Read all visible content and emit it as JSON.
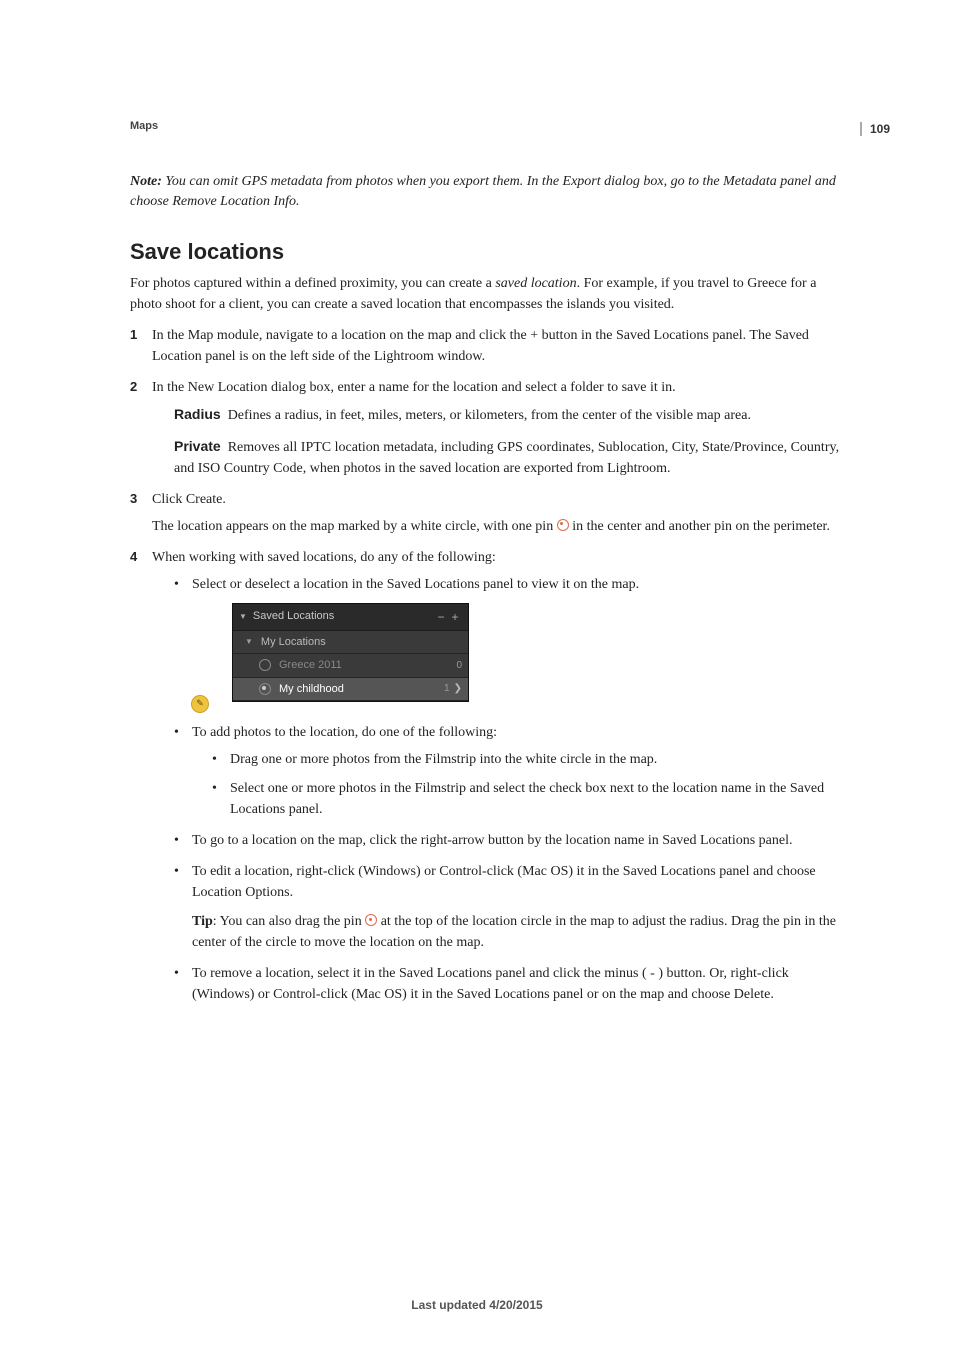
{
  "page_number": "109",
  "running_head": "Maps",
  "note_label": "Note:",
  "note_body": " You can omit GPS metadata from photos when you export them. In the Export dialog box, go to the Metadata panel and choose Remove Location Info.",
  "heading": "Save locations",
  "intro": "For photos captured within a defined proximity, you can create a saved location. For example, if you travel to Greece for a photo shoot for a client, you can create a saved location that encompasses the islands you visited.",
  "intro_emphasis": "saved location",
  "steps": {
    "s1_num": "1",
    "s1": "In the Map module, navigate to a location on the map and click the + button in the Saved Locations panel. The Saved Location panel is on the left side of the Lightroom window.",
    "s2_num": "2",
    "s2": "In the New Location dialog box, enter a name for the location and select a folder to save it in.",
    "def_radius_term": "Radius",
    "def_radius_body": "Defines a radius, in feet, miles, meters, or kilometers, from the center of the visible map area.",
    "def_private_term": "Private",
    "def_private_body": "Removes all IPTC location metadata, including GPS coordinates, Sublocation, City, State/Province, Country, and ISO Country Code, when photos in the saved location are exported from Lightroom.",
    "s3_num": "3",
    "s3": "Click Create.",
    "s3_detail_a": "The location appears on the map marked by a white circle, with one pin ",
    "s3_detail_b": " in the center and another pin on the perimeter.",
    "s4_num": "4",
    "s4": "When working with saved locations, do any of the following:",
    "b_select": "Select or deselect a location in the Saved Locations panel to view it on the map.",
    "b_add": "To add photos to the location, do one of the following:",
    "b_add_sub1": "Drag one or more photos from the Filmstrip into the white circle in the map.",
    "b_add_sub2": "Select one or more photos in the Filmstrip and select the check box next to the location name in the Saved Locations panel.",
    "b_goto": "To go to a location on the map, click the right-arrow button by the location name in Saved Locations panel.",
    "b_edit": "To edit a location, right-click (Windows) or Control-click (Mac OS) it in the Saved Locations panel and choose Location Options.",
    "tip_label": "Tip",
    "tip_body_a": ": You can also drag the pin ",
    "tip_body_b": " at the top of the location circle in the map to adjust the radius. Drag the pin in the center of the circle to move the location on the map.",
    "b_remove": "To remove a location, select it in the Saved Locations panel and click the minus ( - ) button. Or, right-click (Windows) or Control-click (Mac OS) it in the Saved Locations panel or on the map and choose Delete."
  },
  "panel": {
    "title": "Saved Locations",
    "minus": "−",
    "plus": "+",
    "folder": "My Locations",
    "item1_name": "Greece 2011",
    "item1_count": "0",
    "item2_name": "My childhood",
    "item2_count": "1",
    "lock_glyph": "✎"
  },
  "footer": "Last updated 4/20/2015"
}
